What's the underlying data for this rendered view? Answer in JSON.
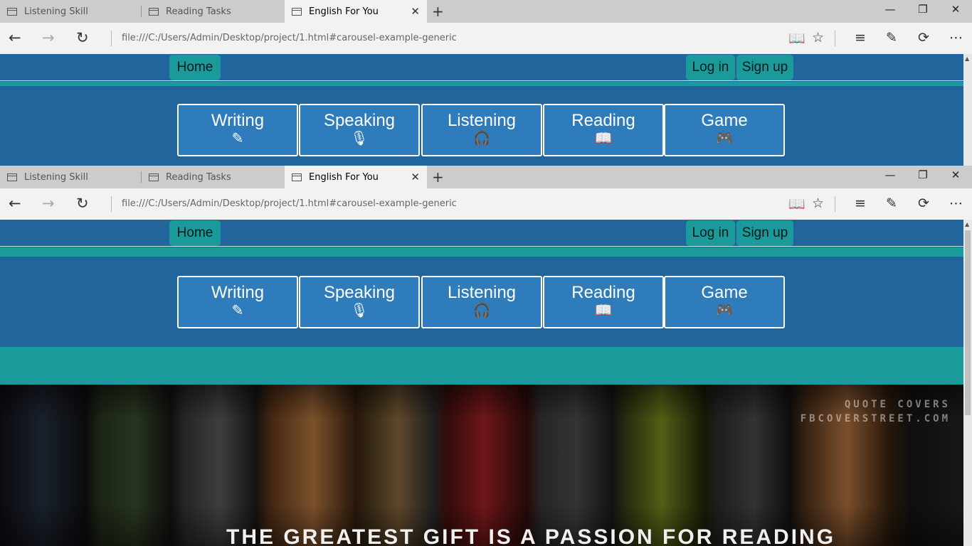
{
  "browser": {
    "tabs": [
      {
        "label": "Listening Skill"
      },
      {
        "label": "Reading Tasks"
      },
      {
        "label": "English For You"
      }
    ],
    "active_tab": "English For You",
    "new_tab_glyph": "+",
    "tab_close_glyph": "✕",
    "window_controls": {
      "minimize": "—",
      "restore": "❐",
      "close": "✕"
    },
    "nav": {
      "back": "←",
      "forward": "→",
      "refresh": "↻"
    },
    "url": "file:///C:/Users/Admin/Desktop/project/1.html#carousel-example-generic",
    "toolbar_icons": [
      "reading-view-icon",
      "favorite-star-icon",
      "hub-icon",
      "web-note-icon",
      "share-icon",
      "more-icon"
    ],
    "toolbar_glyphs": {
      "reading_view": "📖",
      "favorite": "☆",
      "hub": "≡",
      "web_note": "✎",
      "share": "⟳",
      "more": "⋯"
    }
  },
  "site": {
    "nav": {
      "home": "Home",
      "login": "Log in",
      "signup": "Sign up"
    },
    "skills": [
      {
        "label": "Writing",
        "icon": "pencil-icon",
        "glyph": "✎"
      },
      {
        "label": "Speaking",
        "icon": "microphone-icon",
        "glyph": "🎙"
      },
      {
        "label": "Listening",
        "icon": "headphones-icon",
        "glyph": "🎧"
      },
      {
        "label": "Reading",
        "icon": "book-icon",
        "glyph": "📖"
      },
      {
        "label": "Game",
        "icon": "gamepad-icon",
        "glyph": "🎮"
      }
    ],
    "carousel": {
      "watermark_line1": "QUOTE COVERS",
      "watermark_line2": "FBCOVERSTREET.COM",
      "quote": "THE GREATEST GIFT IS A PASSION FOR READING"
    }
  },
  "colors": {
    "page_blue": "#22659c",
    "button_blue": "#2f7cbd",
    "teal": "#1a9a9a",
    "tab_bar": "#cccccc",
    "address_bar": "#f2f2f2"
  }
}
